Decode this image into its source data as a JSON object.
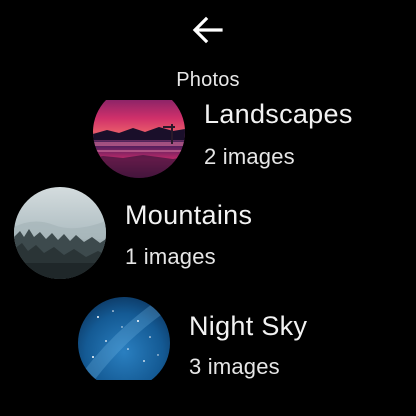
{
  "header": {
    "back_icon": "arrow-left-icon",
    "title": "Photos"
  },
  "albums": [
    {
      "name": "Landscapes",
      "count": "2 images",
      "thumbnail": "sunset-lake"
    },
    {
      "name": "Mountains",
      "count": "1 images",
      "thumbnail": "misty-forest"
    },
    {
      "name": "Night Sky",
      "count": "3 images",
      "thumbnail": "milky-way"
    }
  ],
  "colors": {
    "background": "#000000",
    "text_primary": "#f2f2f2"
  }
}
